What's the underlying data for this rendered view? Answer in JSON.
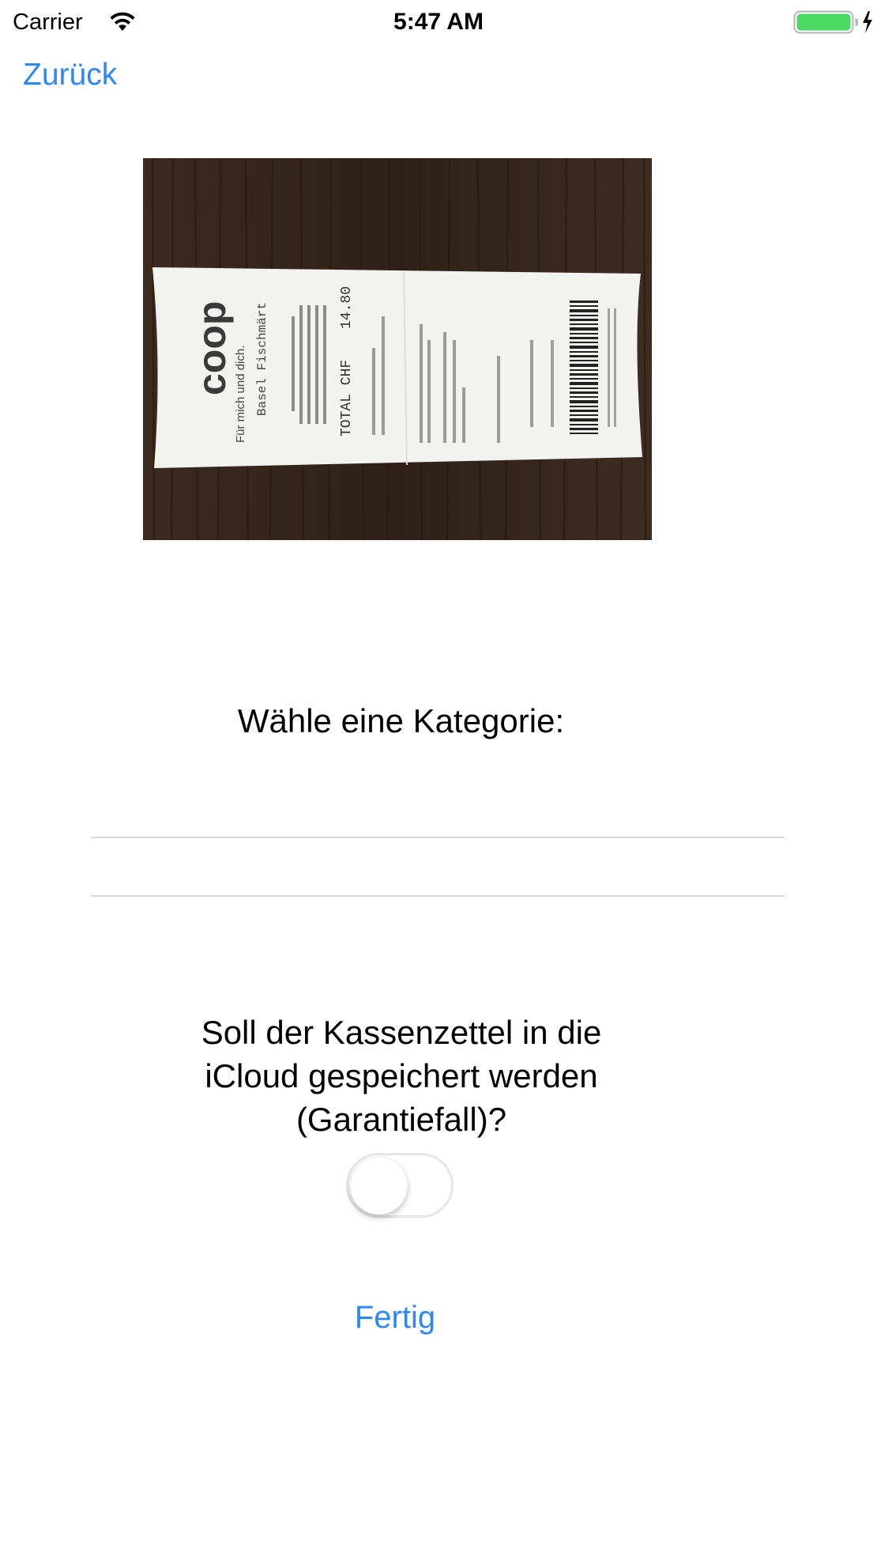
{
  "status_bar": {
    "carrier": "Carrier",
    "time": "5:47 AM",
    "wifi_icon": "wifi-icon",
    "battery_icon": "battery-charging-icon",
    "battery_color": "#4cd964"
  },
  "nav": {
    "back_label": "Zurück"
  },
  "receipt_image": {
    "store_logo": "coop",
    "slogan": "Für mich und dich.",
    "store_name": "Basel Fischmärt",
    "total_label": "TOTAL CHF",
    "total_value": "14.80"
  },
  "category": {
    "heading": "Wähle eine Kategorie:",
    "selected": ""
  },
  "icloud": {
    "question": "Soll der Kassenzettel in die iCloud gespeichert werden (Garantiefall)?",
    "toggle_on": false
  },
  "actions": {
    "done_label": "Fertig"
  },
  "colors": {
    "accent": "#2e87f4",
    "separator": "#d9d9d9",
    "text": "#000000"
  }
}
